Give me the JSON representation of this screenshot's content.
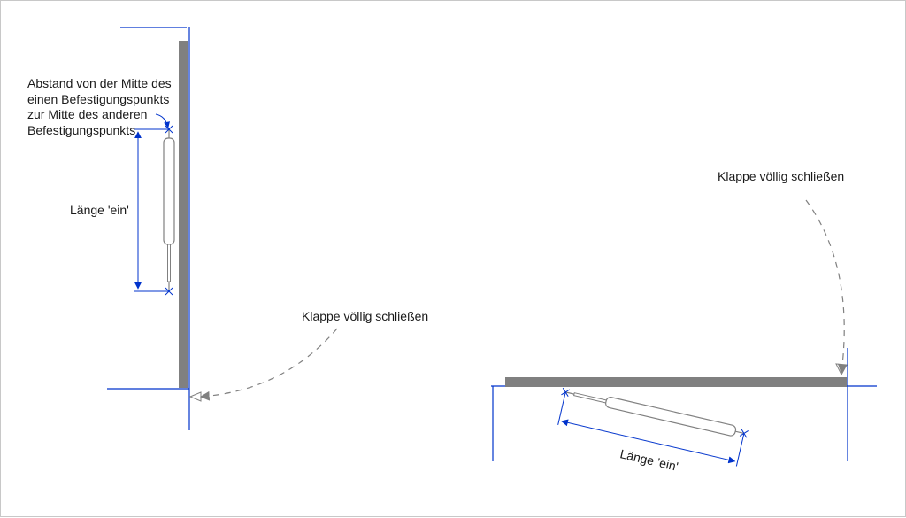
{
  "labels": {
    "mount_distance_note": "Abstand von der Mitte des\neinen Befestigungspunkts\nzur Mitte des anderen\nBefestigungspunkts",
    "length_in_left": "Länge 'ein'",
    "close_flap_left": "Klappe völlig schließen",
    "close_flap_right": "Klappe völlig schließen",
    "length_in_right": "Länge 'ein'"
  },
  "chart_data": {
    "type": "diagram",
    "title": "",
    "description": "Technical diagram showing gas spring mounting on a flap in two positions (vertical open and horizontal closed).",
    "elements": [
      {
        "id": "left-assembly",
        "flap_orientation": "vertical",
        "gas_spring_state": "extended",
        "dimension_label": "Länge 'ein'",
        "dimension_meaning": "Center-to-center distance between mounting points (extended length)",
        "action_annotation": "Klappe völlig schließen",
        "annotation_meaning": "Fully close the flap"
      },
      {
        "id": "right-assembly",
        "flap_orientation": "horizontal",
        "gas_spring_state": "retracted",
        "dimension_label": "Länge 'ein'",
        "action_annotation": "Klappe völlig schließen"
      }
    ],
    "colors": {
      "construction_line": "#0033cc",
      "flap_fill": "#808080",
      "gas_spring_outline": "#808080",
      "dash_arrow": "#808080",
      "text": "#1a1a1a"
    }
  }
}
